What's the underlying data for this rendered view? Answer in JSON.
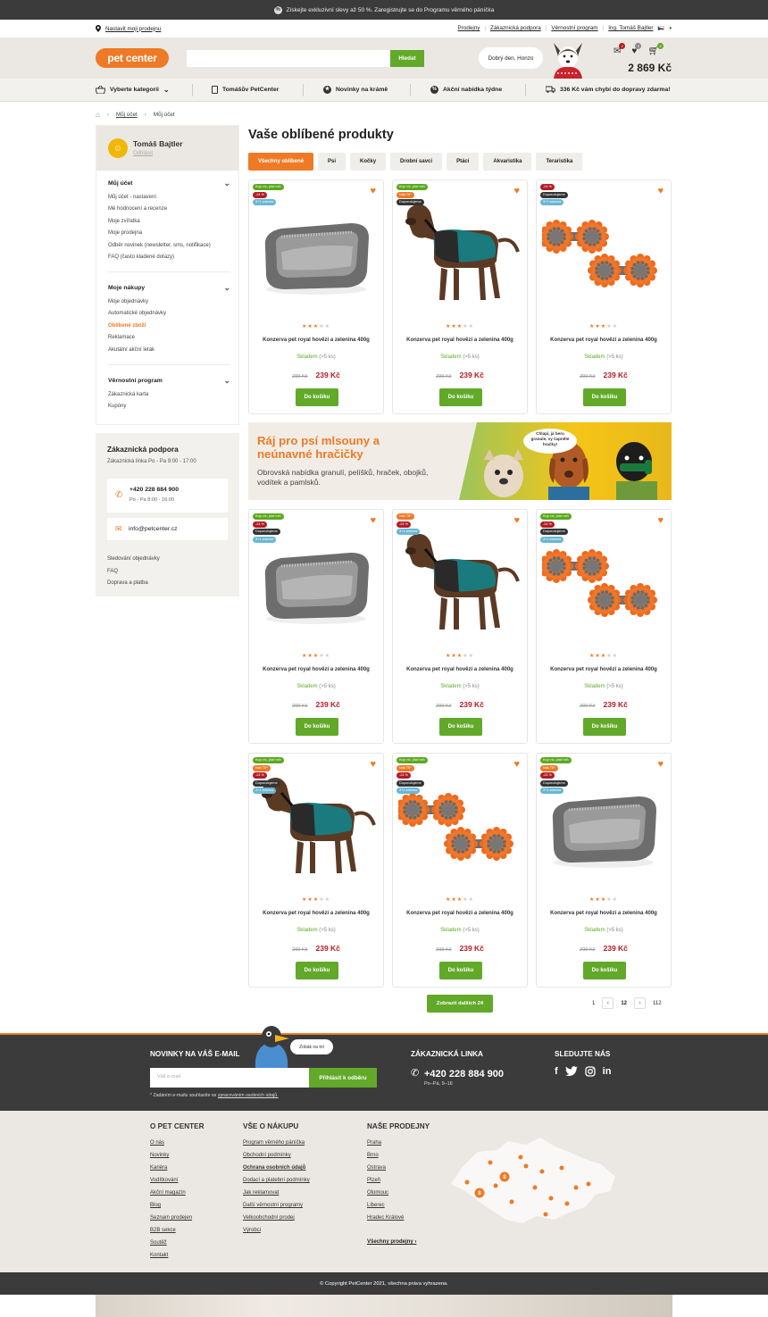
{
  "topbar": {
    "text": "Získejte exkluzivní slevy až 50 %. Zaregistrujte se do Programu věrného páníčka",
    "pct": "%"
  },
  "util": {
    "store": "Nastavit moji prodejnu",
    "links": [
      "Prodejny",
      "Zákaznická podpora",
      "Věrnostní program"
    ],
    "user": "Ing. Tomáš Bajtler"
  },
  "header": {
    "logo": "pet center",
    "search_placeholder": "",
    "search_btn": "Hledat",
    "greeting": "Dobrý den, Honzo",
    "cart_total": "2 869 Kč",
    "badges": [
      "1",
      "3",
      "4"
    ]
  },
  "nav": {
    "categories": "Vyberte kategorii",
    "items": [
      "Tomášův PetCenter",
      "Novinky na krámě",
      "Akční nabídka týdne",
      "336 Kč vám chybí do dopravy zdarma!"
    ]
  },
  "breadcrumb": {
    "items": [
      "Můj účet",
      "Můj účet"
    ]
  },
  "sidebar": {
    "name": "Tomáš Bajtler",
    "logout": "Odhlásit",
    "sections": [
      {
        "title": "Můj účet",
        "items": [
          "Můj účet - nastavení",
          "Mé hodnocení a recenze",
          "Moje zvířatka",
          "Moje prodejna",
          "Odběr novinek (newsletter, sms, notifikace)",
          "FAQ (často kladené dotazy)"
        ]
      },
      {
        "title": "Moje nákupy",
        "items": [
          "Moje objednávky",
          "Automatické objednávky",
          "Oblíbené zboží",
          "Reklamace",
          "Akutální akční leták"
        ],
        "active": 2
      },
      {
        "title": "Věrnostní program",
        "items": [
          "Zákaznická karta",
          "Kupóny"
        ]
      }
    ]
  },
  "support": {
    "title": "Zákaznická podpora",
    "hours": "Zákaznická linka Po - Pa 9:00 - 17:00",
    "phone": "+420 228 884 900",
    "phone_hours": "Po - Pa 8:00 - 16:00",
    "email": "info@petcenter.cz",
    "links": [
      "Sledování objednávky",
      "FAQ",
      "Doprava a platba"
    ]
  },
  "main": {
    "title": "Vaše oblíbené produkty",
    "tabs": [
      "Všechny oblíbené",
      "Psi",
      "Kočky",
      "Drobní savci",
      "Ptáci",
      "Akvaristika",
      "Teraristika"
    ]
  },
  "product_common": {
    "name": "Konzerva pet royal hovězí a zelenina 400g",
    "stock": "Skladem",
    "stock_qty": "(>5 ks)",
    "old_price": "299 Kč",
    "price": "239 Kč",
    "buy": "Do košíku",
    "rating": 3
  },
  "products": [
    {
      "img": "bed",
      "tags": [
        [
          "Kup víc, plať míň",
          "g"
        ],
        [
          "-24 %",
          "r"
        ],
        [
          "3+1 zdarma",
          "b"
        ]
      ]
    },
    {
      "img": "dog",
      "tags": [
        [
          "Kup víc, plať míň",
          "g"
        ],
        [
          "Náš TIP",
          "o"
        ],
        [
          "Doporučujeme",
          "d"
        ]
      ]
    },
    {
      "img": "toy",
      "tags": [
        [
          "-24 %",
          "r"
        ],
        [
          "Doporučujeme",
          "d"
        ],
        [
          "3+1 zdarma",
          "b"
        ]
      ]
    },
    {
      "img": "bed",
      "tags": [
        [
          "Kup víc, plať míň",
          "g"
        ],
        [
          "-24 %",
          "r"
        ],
        [
          "Doporučujeme",
          "d"
        ],
        [
          "3+1 zdarma",
          "b"
        ]
      ]
    },
    {
      "img": "dog",
      "tags": [
        [
          "Náš TIP",
          "o"
        ],
        [
          "-24 %",
          "r"
        ],
        [
          "3+1 zdarma",
          "b"
        ]
      ]
    },
    {
      "img": "toy",
      "tags": [
        [
          "Kup víc, plať míň",
          "g"
        ],
        [
          "-24 %",
          "r"
        ],
        [
          "Doporučujeme",
          "d"
        ],
        [
          "3+1 zdarma",
          "b"
        ]
      ]
    },
    {
      "img": "dog",
      "tags": [
        [
          "Kup víc, plať míň",
          "g"
        ],
        [
          "Náš TIP",
          "o"
        ],
        [
          "-24 %",
          "r"
        ],
        [
          "Doporučujeme",
          "d"
        ],
        [
          "3+1 zdarma",
          "b"
        ]
      ]
    },
    {
      "img": "toy",
      "tags": [
        [
          "Kup víc, plať míň",
          "g"
        ],
        [
          "Náš TIP",
          "o"
        ],
        [
          "-24 %",
          "r"
        ],
        [
          "Doporučujeme",
          "d"
        ],
        [
          "3+1 zdarma",
          "b"
        ]
      ]
    },
    {
      "img": "bed",
      "tags": [
        [
          "Kup víc, plať míň",
          "g"
        ],
        [
          "Náš TIP",
          "o"
        ],
        [
          "-24 %",
          "r"
        ],
        [
          "Doporučujeme",
          "d"
        ],
        [
          "3+1 zdarma",
          "b"
        ]
      ]
    }
  ],
  "banner": {
    "title": "Ráj pro psí mlsouny a neúnavné hračičky",
    "text": "Obrovská nabídka granulí, pelíšků, hraček, obojků, vodítek a pamlsků.",
    "speech": "Chlapi, já beru granule, vy čapněte hračky!"
  },
  "pagination": {
    "more": "Zobrazit dalších 24",
    "pages": [
      "1",
      "12",
      "112"
    ]
  },
  "footer": {
    "newsletter_title": "NOVINKY NA VÁŠ E-MAIL",
    "newsletter_placeholder": "Váš e-mail",
    "newsletter_btn": "Přihlásit k odběru",
    "consent": "* Zadáním e-mailu souhlasíte se",
    "consent_link": "zpracováním osobních údajů.",
    "bird": "Zobák na tní",
    "line_title": "ZÁKAZNICKÁ LINKA",
    "line_phone": "+420 228 884 900",
    "line_hours": "Po–Pá, 9–16",
    "social_title": "SLEDUJTE NÁS",
    "cols": [
      {
        "title": "O PET CENTER",
        "items": [
          "O nás",
          "Novinky",
          "Kariéra",
          "Vodítkování",
          "Akční magazín",
          "Blog",
          "Seznam prodejen",
          "B2B sekce",
          "Soutěž",
          "Kontakt"
        ]
      },
      {
        "title": "VŠE O NÁKUPU",
        "items": [
          "Program věrného páníčka",
          "Obchodní podmínky",
          "Ochrana osobních údajů",
          "Dodací a platební podmínky",
          "Jak reklamovat",
          "Další věrnostní programy",
          "Velkoobchodní prodej",
          "Výrobci"
        ]
      },
      {
        "title": "NAŠE PRODEJNY",
        "items": [
          "Praha",
          "Brno",
          "Ostrava",
          "Plzeň",
          "Olomouc",
          "Liberec",
          "Hradec Králové"
        ]
      }
    ],
    "all_stores": "Všechny prodejny",
    "map_counts": [
      "8",
      "8"
    ],
    "copyright": "© Copyright PetCenter 2021, všechna práva vyhrazena."
  },
  "colors": {
    "orange": "#ee7a26",
    "green": "#62a92a",
    "dark": "#3b3b3b",
    "beige": "#ebe8e3",
    "red": "#b41c25"
  }
}
